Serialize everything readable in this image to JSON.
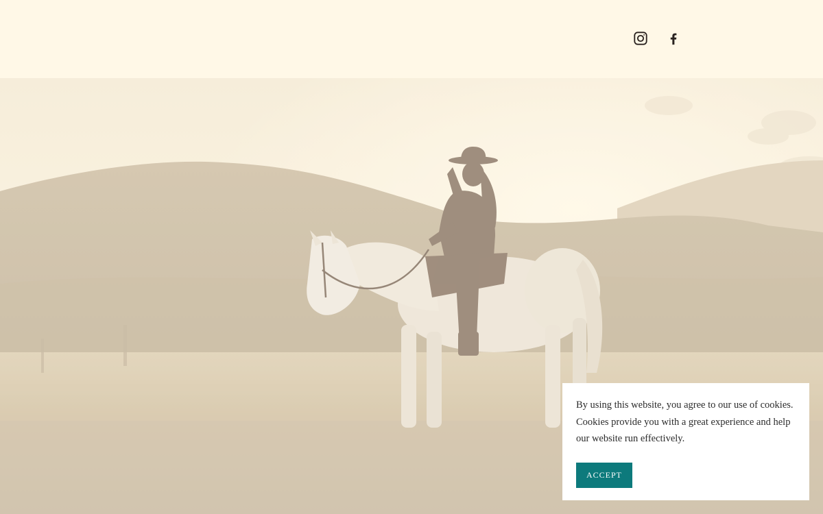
{
  "header": {
    "social": [
      {
        "icon": "instagram-icon",
        "label": "Instagram"
      },
      {
        "icon": "facebook-icon",
        "label": "Facebook"
      }
    ]
  },
  "hero": {
    "image": "horse-rider-sunset-photo",
    "colors": {
      "sky": "#f7efdc",
      "hills_far": "#ddd2bd",
      "hills_near": "#c9bca3",
      "field": "#d6c9ae",
      "horse": "#efe9df",
      "rider": "#8a7868"
    }
  },
  "cookie": {
    "message": "By using this website, you agree to our use of cookies. Cookies provide you with a great experience and help our website run effectively.",
    "accept_label": "ACCEPT",
    "accept_color": "#0d7a7c"
  },
  "theme": {
    "background": "#fff8e7",
    "text": "#2a2320"
  }
}
